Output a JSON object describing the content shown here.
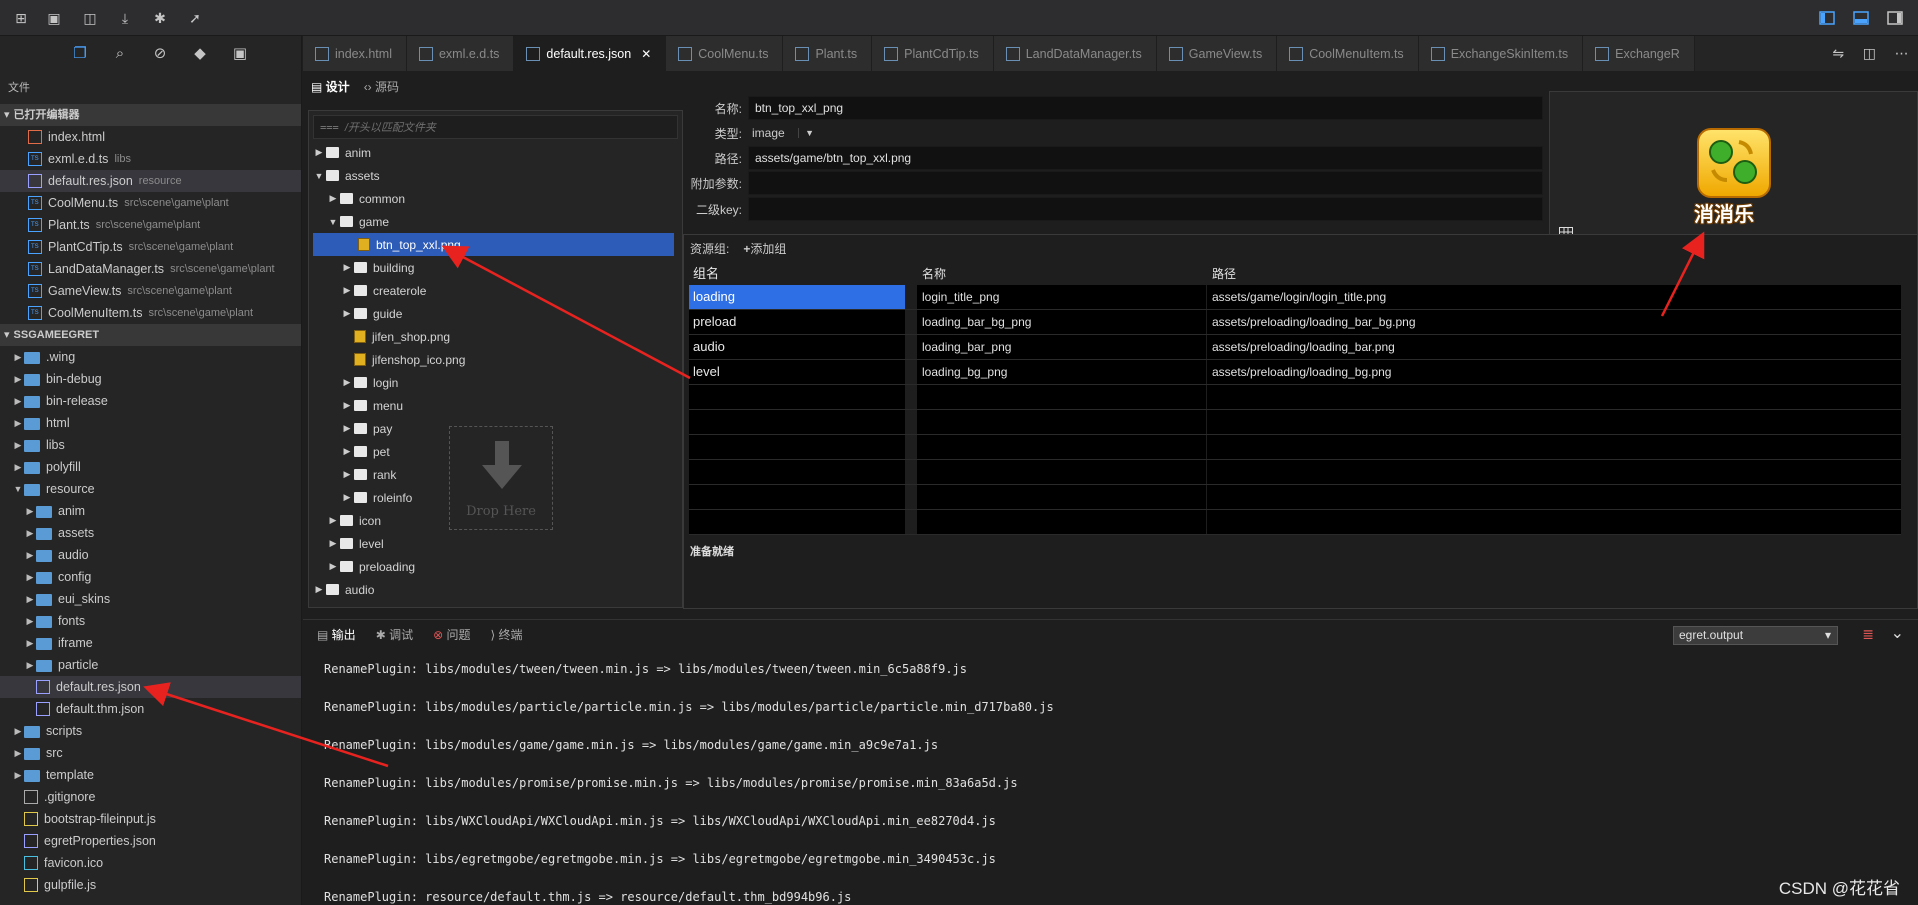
{
  "sidebar": {
    "title": "文件",
    "open_editors_header": "已打开编辑器",
    "open_editors": [
      {
        "label": "index.html",
        "desc": "",
        "type": "html"
      },
      {
        "label": "exml.e.d.ts",
        "desc": "libs",
        "type": "ts"
      },
      {
        "label": "default.res.json",
        "desc": "resource",
        "type": "json"
      },
      {
        "label": "CoolMenu.ts",
        "desc": "src\\scene\\game\\plant",
        "type": "ts"
      },
      {
        "label": "Plant.ts",
        "desc": "src\\scene\\game\\plant",
        "type": "ts"
      },
      {
        "label": "PlantCdTip.ts",
        "desc": "src\\scene\\game\\plant",
        "type": "ts"
      },
      {
        "label": "LandDataManager.ts",
        "desc": "src\\scene\\game\\plant",
        "type": "ts"
      },
      {
        "label": "GameView.ts",
        "desc": "src\\scene\\game\\plant",
        "type": "ts"
      },
      {
        "label": "CoolMenuItem.ts",
        "desc": "src\\scene\\game\\plant",
        "type": "ts"
      }
    ],
    "project_header": "SSGAMEEGRET",
    "project_items": [
      {
        "label": ".wing",
        "depth": 0,
        "kind": "folder",
        "twisty": "▶"
      },
      {
        "label": "bin-debug",
        "depth": 0,
        "kind": "folder",
        "twisty": "▶"
      },
      {
        "label": "bin-release",
        "depth": 0,
        "kind": "folder",
        "twisty": "▶"
      },
      {
        "label": "html",
        "depth": 0,
        "kind": "folder",
        "twisty": "▶"
      },
      {
        "label": "libs",
        "depth": 0,
        "kind": "folder",
        "twisty": "▶"
      },
      {
        "label": "polyfill",
        "depth": 0,
        "kind": "folder",
        "twisty": "▶"
      },
      {
        "label": "resource",
        "depth": 0,
        "kind": "folder",
        "twisty": "▼"
      },
      {
        "label": "anim",
        "depth": 1,
        "kind": "folder",
        "twisty": "▶"
      },
      {
        "label": "assets",
        "depth": 1,
        "kind": "folder",
        "twisty": "▶"
      },
      {
        "label": "audio",
        "depth": 1,
        "kind": "folder",
        "twisty": "▶"
      },
      {
        "label": "config",
        "depth": 1,
        "kind": "folder",
        "twisty": "▶"
      },
      {
        "label": "eui_skins",
        "depth": 1,
        "kind": "folder",
        "twisty": "▶"
      },
      {
        "label": "fonts",
        "depth": 1,
        "kind": "folder",
        "twisty": "▶"
      },
      {
        "label": "iframe",
        "depth": 1,
        "kind": "folder",
        "twisty": "▶"
      },
      {
        "label": "particle",
        "depth": 1,
        "kind": "folder",
        "twisty": "▶"
      },
      {
        "label": "default.res.json",
        "depth": 1,
        "kind": "json",
        "twisty": ""
      },
      {
        "label": "default.thm.json",
        "depth": 1,
        "kind": "json",
        "twisty": ""
      },
      {
        "label": "scripts",
        "depth": 0,
        "kind": "folder",
        "twisty": "▶"
      },
      {
        "label": "src",
        "depth": 0,
        "kind": "folder",
        "twisty": "▶"
      },
      {
        "label": "template",
        "depth": 0,
        "kind": "folder",
        "twisty": "▶"
      },
      {
        "label": ".gitignore",
        "depth": 0,
        "kind": "file",
        "twisty": ""
      },
      {
        "label": "bootstrap-fileinput.js",
        "depth": 0,
        "kind": "js",
        "twisty": ""
      },
      {
        "label": "egretProperties.json",
        "depth": 0,
        "kind": "json",
        "twisty": ""
      },
      {
        "label": "favicon.ico",
        "depth": 0,
        "kind": "ico",
        "twisty": ""
      },
      {
        "label": "gulpfile.js",
        "depth": 0,
        "kind": "js",
        "twisty": ""
      }
    ]
  },
  "tabs": [
    {
      "label": "index.html",
      "active": false
    },
    {
      "label": "exml.e.d.ts",
      "active": false
    },
    {
      "label": "default.res.json",
      "active": true
    },
    {
      "label": "CoolMenu.ts",
      "active": false
    },
    {
      "label": "Plant.ts",
      "active": false
    },
    {
      "label": "PlantCdTip.ts",
      "active": false
    },
    {
      "label": "LandDataManager.ts",
      "active": false
    },
    {
      "label": "GameView.ts",
      "active": false
    },
    {
      "label": "CoolMenuItem.ts",
      "active": false
    },
    {
      "label": "ExchangeSkinItem.ts",
      "active": false
    },
    {
      "label": "ExchangeR",
      "active": false
    }
  ],
  "mode": {
    "design": "设计",
    "source": "源码"
  },
  "tree": {
    "filter_placeholder": "/开头以匹配文件夹",
    "items": [
      {
        "label": "anim",
        "depth": 0,
        "kind": "folder",
        "twisty": "▶"
      },
      {
        "label": "assets",
        "depth": 0,
        "kind": "folder-open",
        "twisty": "▼"
      },
      {
        "label": "common",
        "depth": 1,
        "kind": "folder",
        "twisty": "▶"
      },
      {
        "label": "game",
        "depth": 1,
        "kind": "folder-open",
        "twisty": "▼"
      },
      {
        "label": "btn_top_xxl.png",
        "depth": 2,
        "kind": "image",
        "twisty": "",
        "selected": true
      },
      {
        "label": "building",
        "depth": 2,
        "kind": "folder",
        "twisty": "▶"
      },
      {
        "label": "createrole",
        "depth": 2,
        "kind": "folder",
        "twisty": "▶"
      },
      {
        "label": "guide",
        "depth": 2,
        "kind": "folder",
        "twisty": "▶"
      },
      {
        "label": "jifen_shop.png",
        "depth": 2,
        "kind": "image",
        "twisty": ""
      },
      {
        "label": "jifenshop_ico.png",
        "depth": 2,
        "kind": "image",
        "twisty": ""
      },
      {
        "label": "login",
        "depth": 2,
        "kind": "folder",
        "twisty": "▶"
      },
      {
        "label": "menu",
        "depth": 2,
        "kind": "folder",
        "twisty": "▶"
      },
      {
        "label": "pay",
        "depth": 2,
        "kind": "folder",
        "twisty": "▶"
      },
      {
        "label": "pet",
        "depth": 2,
        "kind": "folder",
        "twisty": "▶"
      },
      {
        "label": "rank",
        "depth": 2,
        "kind": "folder",
        "twisty": "▶"
      },
      {
        "label": "roleinfo",
        "depth": 2,
        "kind": "folder",
        "twisty": "▶"
      },
      {
        "label": "icon",
        "depth": 1,
        "kind": "folder",
        "twisty": "▶"
      },
      {
        "label": "level",
        "depth": 1,
        "kind": "folder",
        "twisty": "▶"
      },
      {
        "label": "preloading",
        "depth": 1,
        "kind": "folder",
        "twisty": "▶"
      },
      {
        "label": "audio",
        "depth": 0,
        "kind": "folder",
        "twisty": "▶"
      }
    ],
    "drop_label": "Drop Here"
  },
  "props": {
    "name_label": "名称:",
    "name_value": "btn_top_xxl_png",
    "type_label": "类型:",
    "type_value": "image",
    "path_label": "路径:",
    "path_value": "assets/game/btn_top_xxl.png",
    "extra_label": "附加参数:",
    "extra_value": "",
    "subkey_label": "二级key:",
    "subkey_value": ""
  },
  "preview": {
    "caption": "消消乐"
  },
  "groups": {
    "label": "资源组:",
    "add_label": "添加组",
    "col_group": "组名",
    "col_name": "名称",
    "col_path": "路径",
    "rows": [
      {
        "group": "loading",
        "name": "login_title_png",
        "path": "assets/game/login/login_title.png",
        "selected": true
      },
      {
        "group": "preload",
        "name": "loading_bar_bg_png",
        "path": "assets/preloading/loading_bar_bg.png",
        "selected": false
      },
      {
        "group": "audio",
        "name": "loading_bar_png",
        "path": "assets/preloading/loading_bar.png",
        "selected": false
      },
      {
        "group": "level",
        "name": "loading_bg_png",
        "path": "assets/preloading/loading_bg.png",
        "selected": false
      }
    ],
    "status": "准备就绪"
  },
  "output": {
    "tabs": [
      "输出",
      "调试",
      "问题",
      "终端"
    ],
    "channel": "egret.output",
    "lines": [
      "RenamePlugin: libs/modules/tween/tween.min.js => libs/modules/tween/tween.min_6c5a88f9.js",
      "RenamePlugin: libs/modules/particle/particle.min.js => libs/modules/particle/particle.min_d717ba80.js",
      "RenamePlugin: libs/modules/game/game.min.js => libs/modules/game/game.min_a9c9e7a1.js",
      "RenamePlugin: libs/modules/promise/promise.min.js => libs/modules/promise/promise.min_83a6a5d.js",
      "RenamePlugin: libs/WXCloudApi/WXCloudApi.min.js => libs/WXCloudApi/WXCloudApi.min_ee8270d4.js",
      "RenamePlugin: libs/egretmgobe/egretmgobe.min.js => libs/egretmgobe/egretmgobe.min_3490453c.js",
      "RenamePlugin: resource/default.thm.js => resource/default.thm_bd994b96.js"
    ]
  },
  "watermark": "CSDN @花花省",
  "colors": {
    "accent": "#2d5bb8",
    "arrow": "#e8231f"
  }
}
